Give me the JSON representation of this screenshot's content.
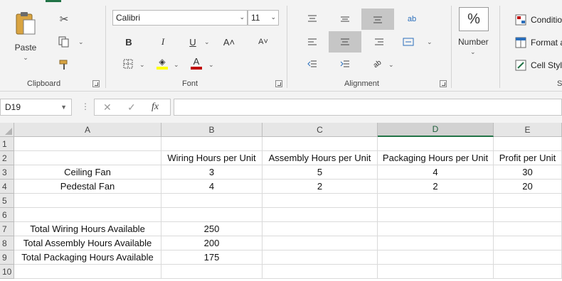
{
  "ribbon": {
    "clipboard": {
      "paste_label": "Paste",
      "group_label": "Clipboard"
    },
    "font": {
      "font_name": "Calibri",
      "font_size": "11",
      "bold": "B",
      "italic": "I",
      "underline": "U",
      "grow": "A˄",
      "shrink": "A˅",
      "group_label": "Font",
      "font_color_swatch": "#c00000",
      "fill_color_swatch": "#ffff00"
    },
    "alignment": {
      "group_label": "Alignment",
      "wrap_glyph": "ab",
      "orientation_glyph": "ab"
    },
    "number": {
      "label": "Number",
      "percent": "%"
    },
    "styles": {
      "conditional": "Conditio",
      "format_as": "Format a",
      "cell_styles": "Cell Style",
      "group_label": "S"
    }
  },
  "formula_bar": {
    "name_box": "D19",
    "cancel": "✕",
    "enter": "✓",
    "fx": "fx",
    "value": ""
  },
  "grid": {
    "columns": [
      "A",
      "B",
      "C",
      "D",
      "E"
    ],
    "active_column": "D",
    "rows": [
      {
        "num": "1",
        "cells": [
          "",
          "",
          "",
          "",
          ""
        ]
      },
      {
        "num": "2",
        "cells": [
          "",
          "Wiring Hours per Unit",
          "Assembly Hours per Unit",
          "Packaging Hours per Unit",
          "Profit per Unit"
        ]
      },
      {
        "num": "3",
        "cells": [
          "Ceiling Fan",
          "3",
          "5",
          "4",
          "30"
        ]
      },
      {
        "num": "4",
        "cells": [
          "Pedestal Fan",
          "4",
          "2",
          "2",
          "20"
        ]
      },
      {
        "num": "5",
        "cells": [
          "",
          "",
          "",
          "",
          ""
        ]
      },
      {
        "num": "6",
        "cells": [
          "",
          "",
          "",
          "",
          ""
        ]
      },
      {
        "num": "7",
        "cells": [
          "Total Wiring Hours Available",
          "250",
          "",
          "",
          ""
        ]
      },
      {
        "num": "8",
        "cells": [
          "Total Assembly Hours Available",
          "200",
          "",
          "",
          ""
        ]
      },
      {
        "num": "9",
        "cells": [
          "Total Packaging Hours Available",
          "175",
          "",
          "",
          ""
        ]
      },
      {
        "num": "10",
        "cells": [
          "",
          "",
          "",
          "",
          ""
        ]
      }
    ]
  },
  "colors": {
    "accent": "#217346",
    "ribbon_bg": "#f3f3f3",
    "header_bg": "#e6e6e6"
  }
}
